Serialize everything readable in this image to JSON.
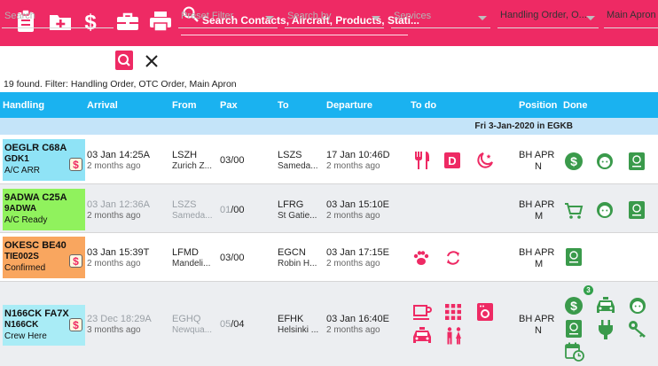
{
  "header": {
    "search_placeholder": "Search Contacts, Aircraft, Products, Stati...",
    "bg_color": "#ee2a64",
    "icons": [
      "clipboard-icon",
      "folder-add-icon",
      "dollar-icon",
      "briefcase-icon",
      "printer-icon",
      "search-icon"
    ]
  },
  "filters": {
    "search_placeholder": "Search",
    "preset_placeholder": "Preset Filter",
    "searchby_placeholder": "Search by",
    "services_placeholder": "Services",
    "order_value": "Handling Order, O...",
    "apron_value": "Main Apron"
  },
  "info_text": "19 found. Filter: Handling Order, OTC Order, Main Apron",
  "columns": {
    "handling": "Handling",
    "arrival": "Arrival",
    "from": "From",
    "pax": "Pax",
    "to": "To",
    "departure": "Departure",
    "todo": "To do",
    "position": "Position",
    "done": "Done"
  },
  "date_band": "Fri 3-Jan-2020 in EGKB",
  "colors": {
    "accent": "#ee2a64",
    "table_header": "#1ab2f0",
    "date_band": "#c4e4f9",
    "done_green": "#3a9a4b",
    "row_cyan": "#8fe3f6",
    "row_green": "#90f25d",
    "row_orange": "#f9a65f",
    "row_lightcyan": "#a9ecf6"
  },
  "rows": [
    {
      "reg": "OEGLR",
      "type": "C68A",
      "flight": "GDK1",
      "status": "A/C ARR",
      "status_color": "#8fe3f6",
      "arr_time": "03 Jan 14:25A",
      "arr_ago": "2 months ago",
      "from_code": "LSZH",
      "from_name": "Zurich Z...",
      "pax_a": "03",
      "pax_b": "/00",
      "to_code": "LSZS",
      "to_name": "Sameda...",
      "dep_time": "17 Jan 10:46D",
      "dep_ago": "2 months ago",
      "pos_a": "BH APR",
      "pos_b": "N"
    },
    {
      "reg": "9ADWA",
      "type": "C25A",
      "flight": "9ADWA",
      "status": "A/C Ready",
      "status_color": "#90f25d",
      "arr_time": "03 Jan 12:36A",
      "arr_ago": "2 months ago",
      "from_code": "LSZS",
      "from_name": "Sameda...",
      "pax_a": "01",
      "pax_b": "/00",
      "to_code": "LFRG",
      "to_name": "St Gatie...",
      "dep_time": "03 Jan 15:10E",
      "dep_ago": "2 months ago",
      "pos_a": "BH APR",
      "pos_b": "M"
    },
    {
      "reg": "OKESC",
      "type": "BE40",
      "flight": "TIE002S",
      "status": "Confirmed",
      "status_color": "#f9a65f",
      "arr_time": "03 Jan 15:39T",
      "arr_ago": "2 months ago",
      "from_code": "LFMD",
      "from_name": "Mandeli...",
      "pax_a": "03",
      "pax_b": "/00",
      "to_code": "EGCN",
      "to_name": "Robin H...",
      "dep_time": "03 Jan 17:15E",
      "dep_ago": "2 months ago",
      "pos_a": "BH APR",
      "pos_b": "M"
    },
    {
      "reg": "N166CK",
      "type": "FA7X",
      "flight": "N166CK",
      "status": "Crew Here",
      "status_color": "#a9ecf6",
      "arr_time": "23 Dec 18:29A",
      "arr_ago": "3 months ago",
      "from_code": "EGHQ",
      "from_name": "Newqua...",
      "pax_a": "05",
      "pax_b": "/04",
      "to_code": "EFHK",
      "to_name": "Helsinki ...",
      "dep_time": "03 Jan 16:40E",
      "dep_ago": "2 months ago",
      "pos_a": "BH APR",
      "pos_b": "N",
      "done_badge": "3"
    }
  ]
}
